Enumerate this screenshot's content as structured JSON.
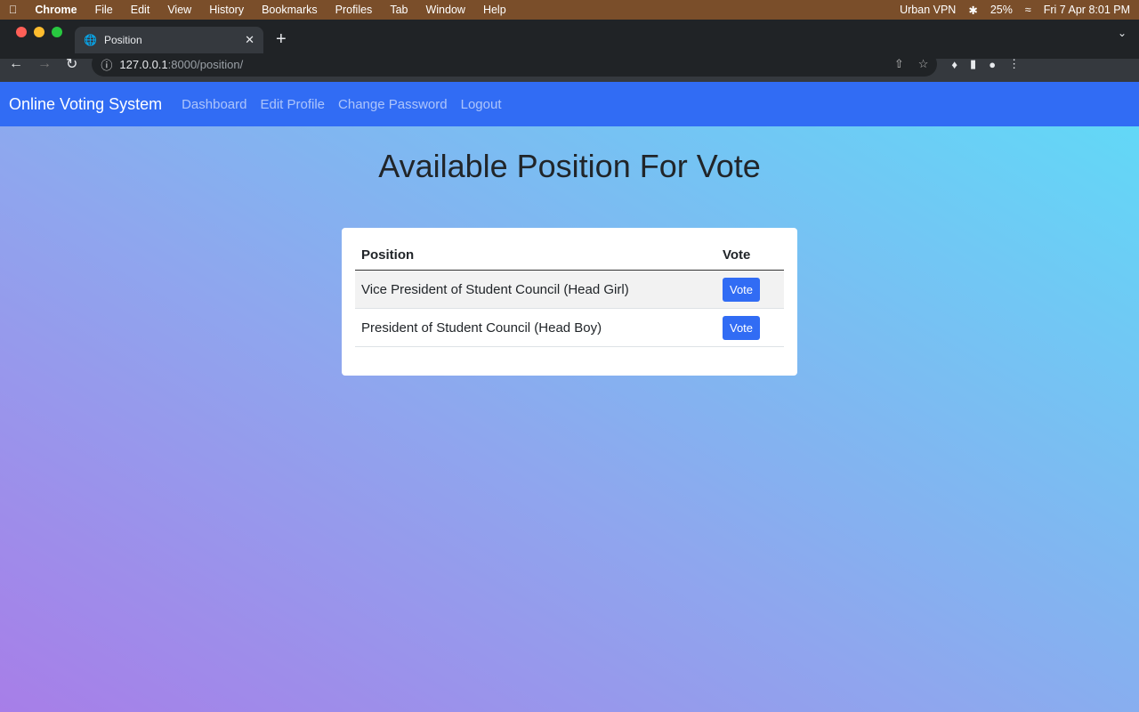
{
  "menubar": {
    "app": "Chrome",
    "items": [
      "File",
      "Edit",
      "View",
      "History",
      "Bookmarks",
      "Profiles",
      "Tab",
      "Window",
      "Help"
    ],
    "vpn": "Urban VPN",
    "battery": "25%",
    "datetime": "Fri 7 Apr  8:01 PM"
  },
  "browser": {
    "tab_title": "Position",
    "url_host": "127.0.0.1",
    "url_rest": ":8000/position/"
  },
  "navbar": {
    "brand": "Online Voting System",
    "links": [
      "Dashboard",
      "Edit Profile",
      "Change Password",
      "Logout"
    ]
  },
  "page": {
    "title": "Available Position For Vote"
  },
  "table": {
    "headers": [
      "Position",
      "Vote"
    ],
    "rows": [
      {
        "position": "Vice President of Student Council (Head Girl)",
        "action": "Vote"
      },
      {
        "position": "President of Student Council (Head Boy)",
        "action": "Vote"
      }
    ]
  }
}
